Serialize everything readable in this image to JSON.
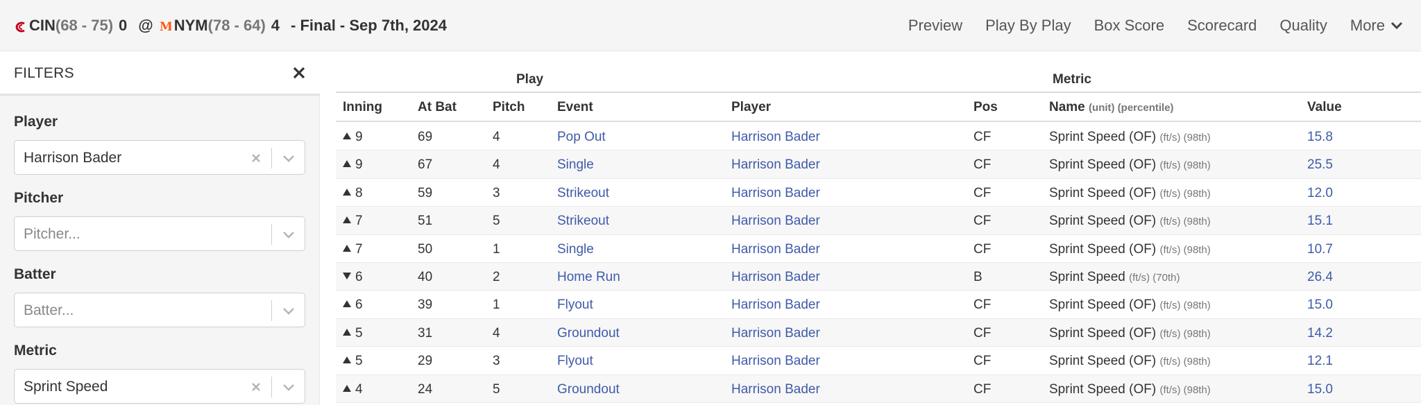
{
  "header": {
    "away_team": "CIN",
    "away_record": "(68 - 75)",
    "away_score": "0",
    "at": "@",
    "home_team": "NYM",
    "home_record": "(78 - 64)",
    "home_score": "4",
    "status": "- Final - Sep 7th, 2024",
    "nav": [
      "Preview",
      "Play By Play",
      "Box Score",
      "Scorecard",
      "Quality"
    ],
    "more_label": "More",
    "away_color": "#c6011f",
    "home_color": "#ff5910"
  },
  "sidebar": {
    "title": "FILTERS",
    "filters": [
      {
        "label": "Player",
        "value": "Harrison Bader",
        "placeholder": "",
        "clearable": true
      },
      {
        "label": "Pitcher",
        "value": "",
        "placeholder": "Pitcher...",
        "clearable": false
      },
      {
        "label": "Batter",
        "value": "",
        "placeholder": "Batter...",
        "clearable": false
      },
      {
        "label": "Metric",
        "value": "Sprint Speed",
        "placeholder": "",
        "clearable": true
      }
    ]
  },
  "table": {
    "group_play": "Play",
    "group_metric": "Metric",
    "columns": {
      "inning": "Inning",
      "at_bat": "At Bat",
      "pitch": "Pitch",
      "event": "Event",
      "player": "Player",
      "pos": "Pos",
      "name": "Name",
      "name_sub": "(unit) (percentile)",
      "value": "Value"
    },
    "rows": [
      {
        "half": "up",
        "inning": "9",
        "at_bat": "69",
        "pitch": "4",
        "event": "Pop Out",
        "player": "Harrison Bader",
        "pos": "CF",
        "metric": "Sprint Speed (OF)",
        "unit": "(ft/s) (98th)",
        "value": "15.8"
      },
      {
        "half": "up",
        "inning": "9",
        "at_bat": "67",
        "pitch": "4",
        "event": "Single",
        "player": "Harrison Bader",
        "pos": "CF",
        "metric": "Sprint Speed (OF)",
        "unit": "(ft/s) (98th)",
        "value": "25.5"
      },
      {
        "half": "up",
        "inning": "8",
        "at_bat": "59",
        "pitch": "3",
        "event": "Strikeout",
        "player": "Harrison Bader",
        "pos": "CF",
        "metric": "Sprint Speed (OF)",
        "unit": "(ft/s) (98th)",
        "value": "12.0"
      },
      {
        "half": "up",
        "inning": "7",
        "at_bat": "51",
        "pitch": "5",
        "event": "Strikeout",
        "player": "Harrison Bader",
        "pos": "CF",
        "metric": "Sprint Speed (OF)",
        "unit": "(ft/s) (98th)",
        "value": "15.1"
      },
      {
        "half": "up",
        "inning": "7",
        "at_bat": "50",
        "pitch": "1",
        "event": "Single",
        "player": "Harrison Bader",
        "pos": "CF",
        "metric": "Sprint Speed (OF)",
        "unit": "(ft/s) (98th)",
        "value": "10.7"
      },
      {
        "half": "down",
        "inning": "6",
        "at_bat": "40",
        "pitch": "2",
        "event": "Home Run",
        "player": "Harrison Bader",
        "pos": "B",
        "metric": "Sprint Speed",
        "unit": "(ft/s) (70th)",
        "value": "26.4"
      },
      {
        "half": "up",
        "inning": "6",
        "at_bat": "39",
        "pitch": "1",
        "event": "Flyout",
        "player": "Harrison Bader",
        "pos": "CF",
        "metric": "Sprint Speed (OF)",
        "unit": "(ft/s) (98th)",
        "value": "15.0"
      },
      {
        "half": "up",
        "inning": "5",
        "at_bat": "31",
        "pitch": "4",
        "event": "Groundout",
        "player": "Harrison Bader",
        "pos": "CF",
        "metric": "Sprint Speed (OF)",
        "unit": "(ft/s) (98th)",
        "value": "14.2"
      },
      {
        "half": "up",
        "inning": "5",
        "at_bat": "29",
        "pitch": "3",
        "event": "Flyout",
        "player": "Harrison Bader",
        "pos": "CF",
        "metric": "Sprint Speed (OF)",
        "unit": "(ft/s) (98th)",
        "value": "12.1"
      },
      {
        "half": "up",
        "inning": "4",
        "at_bat": "24",
        "pitch": "5",
        "event": "Groundout",
        "player": "Harrison Bader",
        "pos": "CF",
        "metric": "Sprint Speed (OF)",
        "unit": "(ft/s) (98th)",
        "value": "15.0"
      }
    ]
  }
}
